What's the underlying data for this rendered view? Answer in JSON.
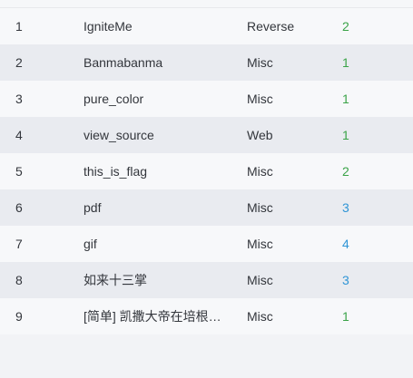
{
  "colors": {
    "score_green": "#3aa348",
    "score_blue": "#2f95d6"
  },
  "rows": [
    {
      "num": "1",
      "name": "IgniteMe",
      "category": "Reverse",
      "score": "2",
      "score_color": "green"
    },
    {
      "num": "2",
      "name": "Banmabanma",
      "category": "Misc",
      "score": "1",
      "score_color": "green"
    },
    {
      "num": "3",
      "name": "pure_color",
      "category": "Misc",
      "score": "1",
      "score_color": "green"
    },
    {
      "num": "4",
      "name": "view_source",
      "category": "Web",
      "score": "1",
      "score_color": "green"
    },
    {
      "num": "5",
      "name": "this_is_flag",
      "category": "Misc",
      "score": "2",
      "score_color": "green"
    },
    {
      "num": "6",
      "name": "pdf",
      "category": "Misc",
      "score": "3",
      "score_color": "blue"
    },
    {
      "num": "7",
      "name": "gif",
      "category": "Misc",
      "score": "4",
      "score_color": "blue"
    },
    {
      "num": "8",
      "name": "如来十三掌",
      "category": "Misc",
      "score": "3",
      "score_color": "blue"
    },
    {
      "num": "9",
      "name": "[简单] 凯撒大帝在培根…",
      "category": "Misc",
      "score": "1",
      "score_color": "green"
    }
  ]
}
